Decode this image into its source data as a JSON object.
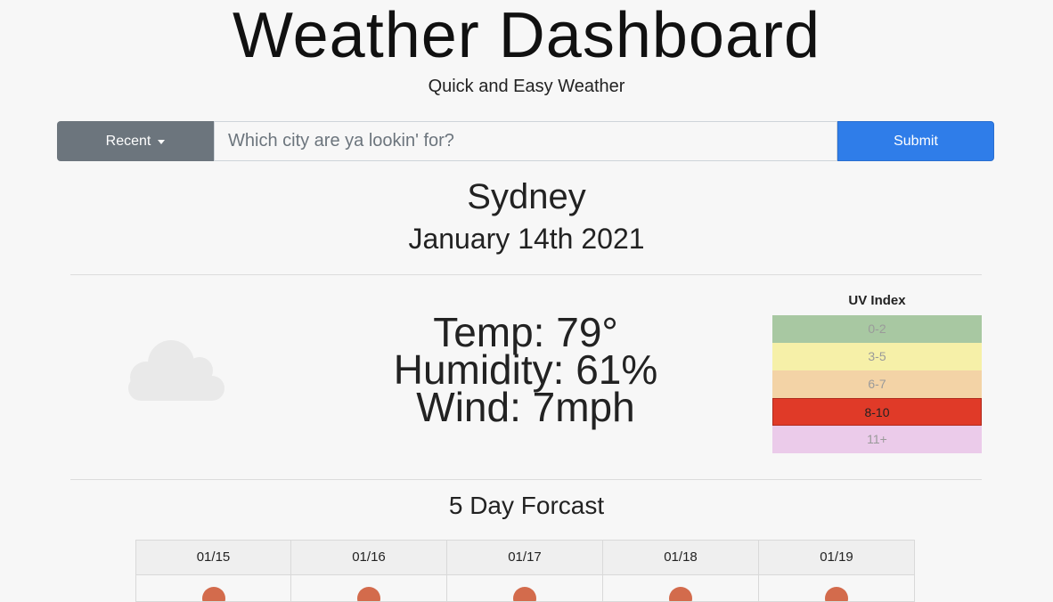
{
  "header": {
    "title": "Weather Dashboard",
    "subtitle": "Quick and Easy Weather"
  },
  "search": {
    "recent_label": "Recent",
    "placeholder": "Which city are ya lookin' for?",
    "value": "",
    "submit_label": "Submit"
  },
  "current": {
    "city": "Sydney",
    "date": "January 14th 2021",
    "icon": "cloud-icon",
    "temp": "Temp: 79°",
    "humidity": "Humidity: 61%",
    "wind": "Wind: 7mph"
  },
  "uv": {
    "title": "UV Index",
    "levels": [
      {
        "label": "0-2",
        "color": "#a8c8a2"
      },
      {
        "label": "3-5",
        "color": "#f6f0a8"
      },
      {
        "label": "6-7",
        "color": "#f3d3a6"
      },
      {
        "label": "8-10",
        "color": "#e03a28"
      },
      {
        "label": "11+",
        "color": "#ebcbea"
      }
    ],
    "active_level": "8-10"
  },
  "forecast": {
    "title": "5 Day Forcast",
    "days": [
      {
        "date": "01/15",
        "icon": "sun-icon"
      },
      {
        "date": "01/16",
        "icon": "sun-icon"
      },
      {
        "date": "01/17",
        "icon": "sun-icon"
      },
      {
        "date": "01/18",
        "icon": "sun-icon"
      },
      {
        "date": "01/19",
        "icon": "sun-icon"
      }
    ]
  }
}
